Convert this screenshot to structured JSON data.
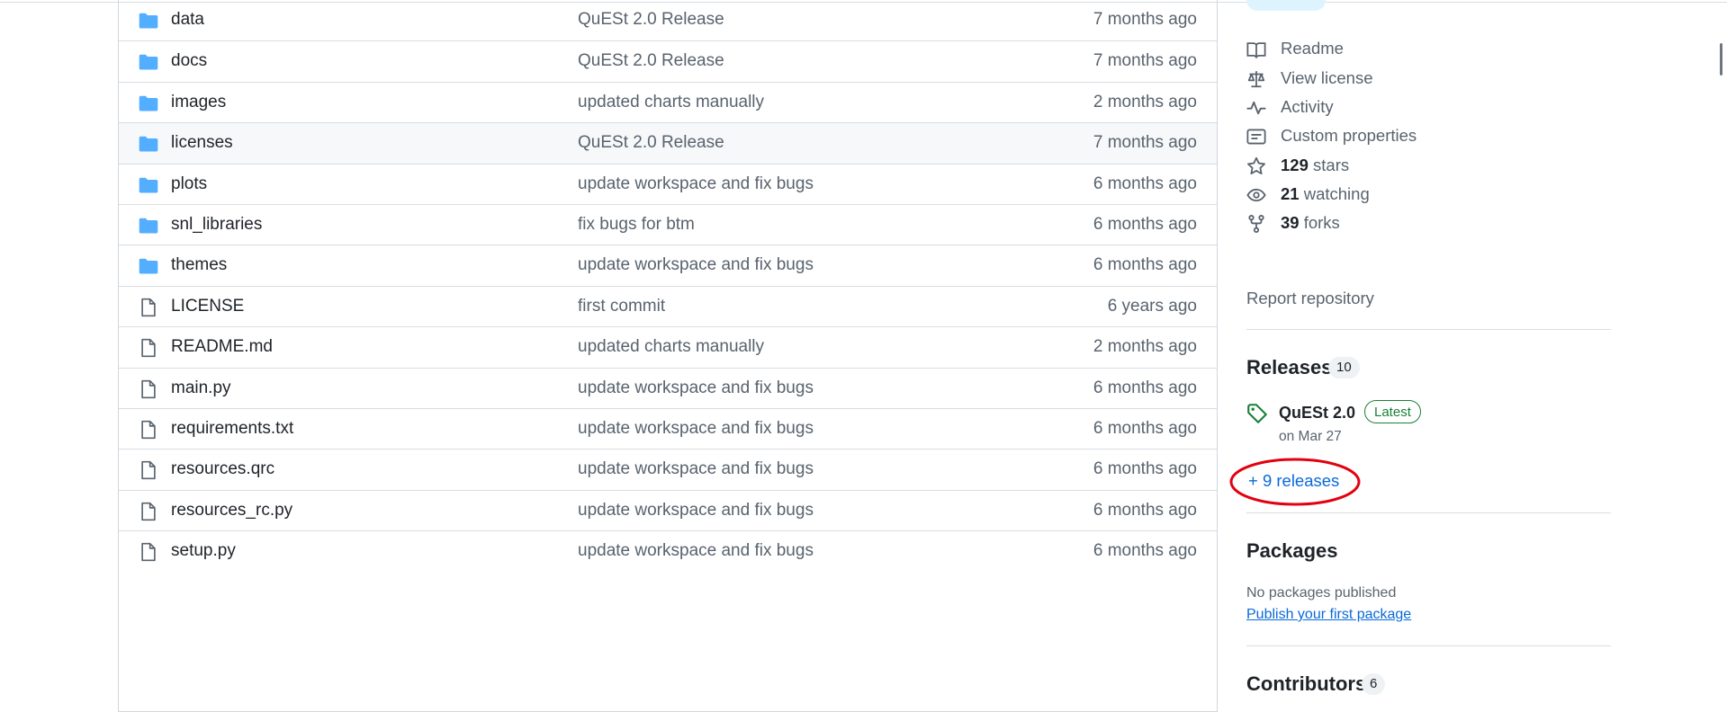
{
  "files": [
    {
      "name": "data",
      "type": "folder",
      "message": "QuESt 2.0 Release",
      "age": "7 months ago"
    },
    {
      "name": "docs",
      "type": "folder",
      "message": "QuESt 2.0 Release",
      "age": "7 months ago"
    },
    {
      "name": "images",
      "type": "folder",
      "message": "updated charts manually",
      "age": "2 months ago"
    },
    {
      "name": "licenses",
      "type": "folder",
      "message": "QuESt 2.0 Release",
      "age": "7 months ago"
    },
    {
      "name": "plots",
      "type": "folder",
      "message": "update workspace and fix bugs",
      "age": "6 months ago"
    },
    {
      "name": "snl_libraries",
      "type": "folder",
      "message": "fix bugs for btm",
      "age": "6 months ago"
    },
    {
      "name": "themes",
      "type": "folder",
      "message": "update workspace and fix bugs",
      "age": "6 months ago"
    },
    {
      "name": "LICENSE",
      "type": "file",
      "message": "first commit",
      "age": "6 years ago"
    },
    {
      "name": "README.md",
      "type": "file",
      "message": "updated charts manually",
      "age": "2 months ago"
    },
    {
      "name": "main.py",
      "type": "file",
      "message": "update workspace and fix bugs",
      "age": "6 months ago"
    },
    {
      "name": "requirements.txt",
      "type": "file",
      "message": "update workspace and fix bugs",
      "age": "6 months ago"
    },
    {
      "name": "resources.qrc",
      "type": "file",
      "message": "update workspace and fix bugs",
      "age": "6 months ago"
    },
    {
      "name": "resources_rc.py",
      "type": "file",
      "message": "update workspace and fix bugs",
      "age": "6 months ago"
    },
    {
      "name": "setup.py",
      "type": "file",
      "message": "update workspace and fix bugs",
      "age": "6 months ago"
    }
  ],
  "highlighted_row": "licenses",
  "sidebar": {
    "about": {
      "readme": "Readme",
      "license": "View license",
      "activity": "Activity",
      "custom_properties": "Custom properties",
      "stars_count": "129",
      "stars_label": "stars",
      "watching_count": "21",
      "watching_label": "watching",
      "forks_count": "39",
      "forks_label": "forks",
      "report": "Report repository"
    },
    "releases": {
      "title": "Releases",
      "count": "10",
      "latest_name": "QuESt 2.0",
      "latest_badge": "Latest",
      "latest_date": "on Mar 27",
      "more_link": "+ 9 releases"
    },
    "packages": {
      "title": "Packages",
      "empty_text": "No packages published",
      "publish_link": "Publish your first package"
    },
    "contributors": {
      "title": "Contributors",
      "count": "6"
    }
  },
  "colors": {
    "folder_icon": "#54aeff",
    "link": "#0969da",
    "latest_green": "#1a7f37",
    "annotation_red": "#e3000f"
  }
}
